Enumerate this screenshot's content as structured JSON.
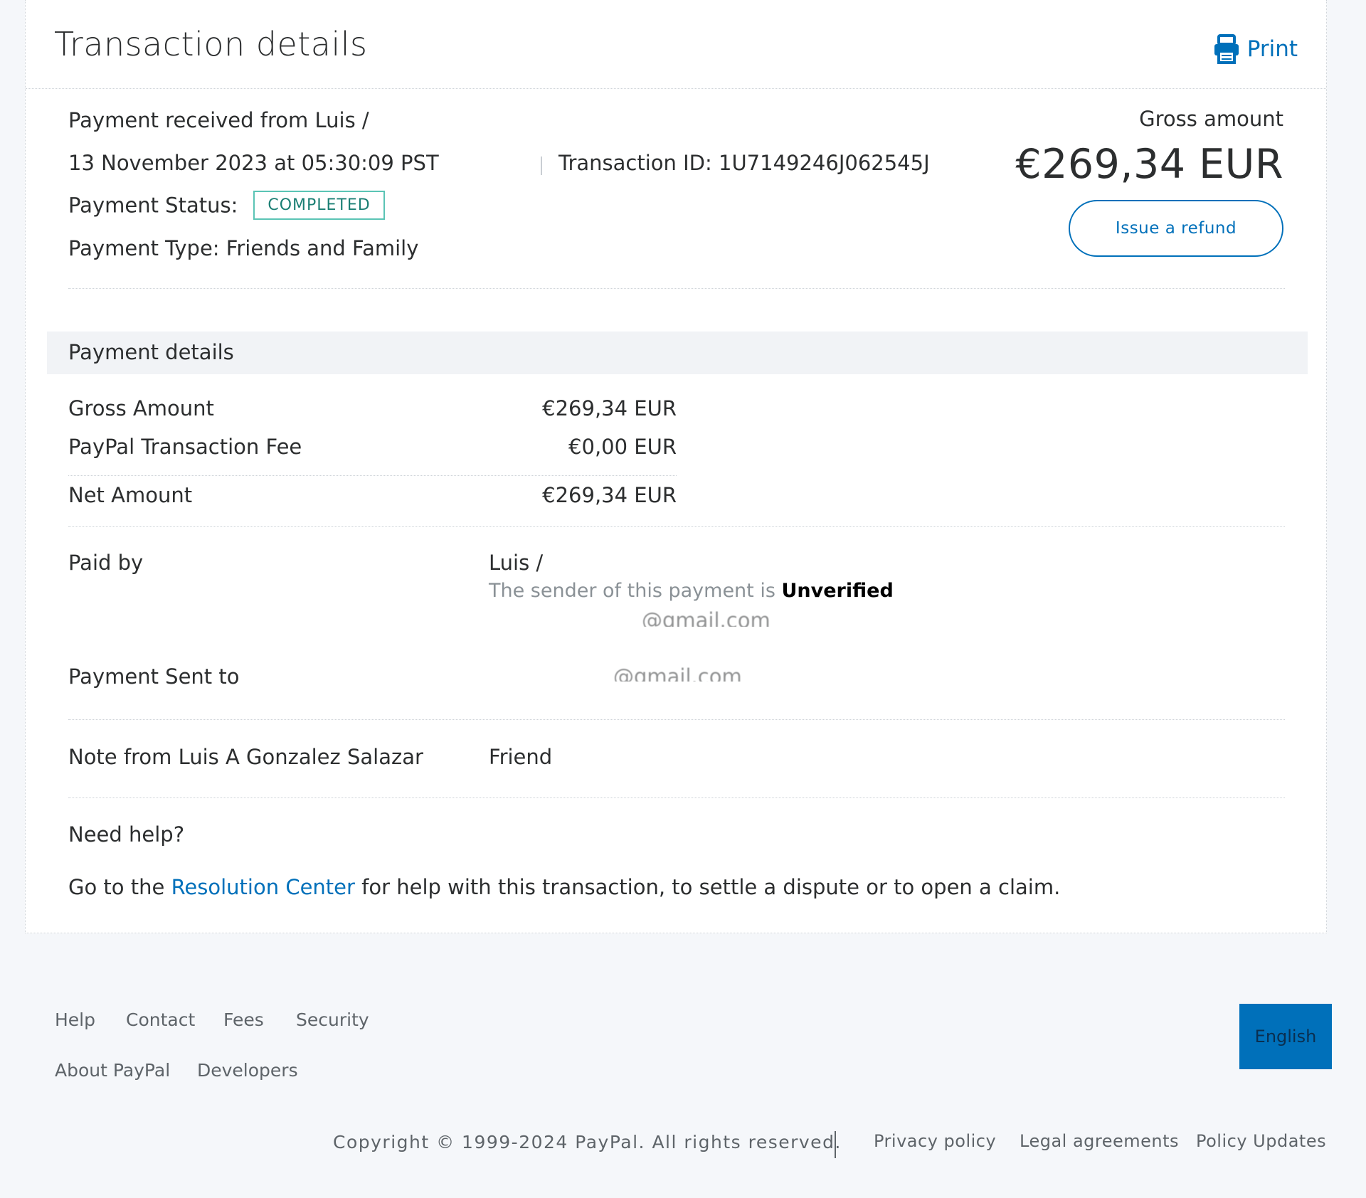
{
  "header": {
    "title": "Transaction details",
    "print_label": "Print"
  },
  "summary": {
    "received_from": "Payment received from Luis /",
    "date": "13 November 2023 at 05:30:09 PST",
    "transaction_id": "Transaction ID: 1U7149246J062545J",
    "status_label": "Payment Status:",
    "status_value": "COMPLETED",
    "payment_type": "Payment Type: Friends and Family",
    "gross_label": "Gross amount",
    "gross_value": "€269,34 EUR",
    "refund_label": "Issue a refund"
  },
  "details": {
    "section_title": "Payment details",
    "gross_label": "Gross Amount",
    "gross_value": "€269,34 EUR",
    "fee_label": "PayPal Transaction Fee",
    "fee_value": "€0,00 EUR",
    "net_label": "Net Amount",
    "net_value": "€269,34 EUR",
    "paid_by_label": "Paid by",
    "paid_by_name": "Luis /",
    "sender_note": "The sender of this payment is",
    "sender_status": "Unverified",
    "paid_by_email": "@gmail.com",
    "sent_to_label": "Payment Sent to",
    "sent_to_value": "@gmail.com",
    "note_label": "Note from Luis A Gonzalez Salazar",
    "note_value": "Friend"
  },
  "help": {
    "title": "Need help?",
    "text_before": "Go to the",
    "link": "Resolution Center",
    "text_after": "for help with this transaction, to settle a dispute or to open a claim."
  },
  "footer": {
    "links_row1": [
      "Help",
      "Contact",
      "Fees",
      "Security"
    ],
    "links_row2": [
      "About PayPal",
      "Developers"
    ],
    "language": "English",
    "copyright": "Copyright © 1999-2024 PayPal. All rights reserved.",
    "legal_links": [
      "Privacy policy",
      "Legal agreements",
      "Policy Updates"
    ]
  },
  "colors": {
    "accent": "#0070ba",
    "status_border": "#5bc4b5",
    "text": "#2c2e2f",
    "section_bg": "#f1f3f6"
  },
  "icons": {
    "print": "printer-icon"
  }
}
